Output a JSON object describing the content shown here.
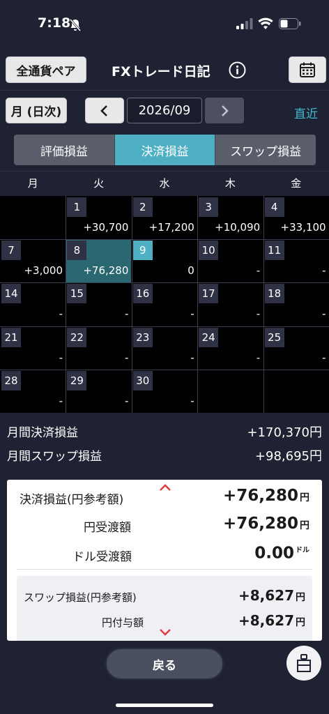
{
  "status": {
    "time": "7:18"
  },
  "header": {
    "pair_button": "全通貨ペア",
    "title": "FXトレード日記"
  },
  "nav": {
    "mode_button": "月 (日次)",
    "date": "2026/09",
    "latest_link": "直近"
  },
  "tabs": [
    {
      "label": "評価損益",
      "active": false
    },
    {
      "label": "決済損益",
      "active": true
    },
    {
      "label": "スワップ損益",
      "active": false
    }
  ],
  "weekdays": [
    "月",
    "火",
    "水",
    "木",
    "金"
  ],
  "calendar": {
    "rows": [
      [
        {
          "day": "",
          "pl": ""
        },
        {
          "day": "1",
          "pl": "+30,700"
        },
        {
          "day": "2",
          "pl": "+17,200"
        },
        {
          "day": "3",
          "pl": "+10,090"
        },
        {
          "day": "4",
          "pl": "+33,100"
        }
      ],
      [
        {
          "day": "7",
          "pl": "+3,000"
        },
        {
          "day": "8",
          "pl": "+76,280",
          "selected": true
        },
        {
          "day": "9",
          "pl": "0",
          "today": true
        },
        {
          "day": "10",
          "pl": "-"
        },
        {
          "day": "11",
          "pl": "-"
        }
      ],
      [
        {
          "day": "14",
          "pl": "-"
        },
        {
          "day": "15",
          "pl": "-"
        },
        {
          "day": "16",
          "pl": "-"
        },
        {
          "day": "17",
          "pl": "-"
        },
        {
          "day": "18",
          "pl": "-"
        }
      ],
      [
        {
          "day": "21",
          "pl": "-"
        },
        {
          "day": "22",
          "pl": "-"
        },
        {
          "day": "23",
          "pl": "-"
        },
        {
          "day": "24",
          "pl": "-"
        },
        {
          "day": "25",
          "pl": "-"
        }
      ],
      [
        {
          "day": "28",
          "pl": "-"
        },
        {
          "day": "29",
          "pl": "-"
        },
        {
          "day": "30",
          "pl": "-"
        },
        {
          "day": "",
          "pl": ""
        },
        {
          "day": "",
          "pl": ""
        }
      ]
    ]
  },
  "summary": {
    "settled_label": "月間決済損益",
    "settled_value": "+170,370円",
    "swap_label": "月間スワップ損益",
    "swap_value": "+98,695円"
  },
  "detail": {
    "settled_label": "決済損益(円参考額)",
    "settled_value": "+76,280",
    "settled_unit": "円",
    "jpy_label": "円受渡額",
    "jpy_value": "+76,280",
    "jpy_unit": "円",
    "usd_label": "ドル受渡額",
    "usd_value": "0.00",
    "usd_unit": "ドル",
    "swap_label": "スワップ損益(円参考額)",
    "swap_value": "+8,627",
    "swap_unit": "円",
    "swap_grant_label": "円付与額",
    "swap_grant_value": "+8,627",
    "swap_grant_unit": "円"
  },
  "footer": {
    "back_button": "戻る"
  }
}
